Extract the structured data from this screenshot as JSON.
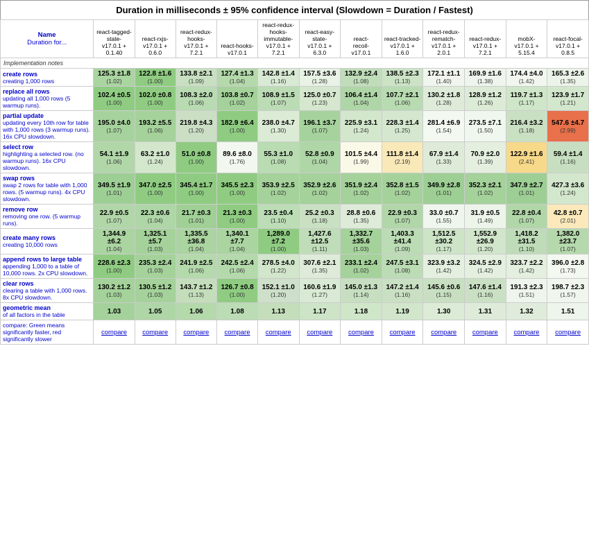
{
  "title": "Duration in milliseconds ± 95% confidence interval (Slowdown = Duration / Fastest)",
  "columns": [
    {
      "id": "name",
      "label": "Name\nDuration for..."
    },
    {
      "id": "c1",
      "label": "react-tagged-state-\nv17.0.1 +\n0.1.40"
    },
    {
      "id": "c2",
      "label": "react-rxjs-\nv17.0.1 +\n0.6.0"
    },
    {
      "id": "c3",
      "label": "react-redux-hooks-\nv17.0.1 +\n7.2.1"
    },
    {
      "id": "c4",
      "label": "react-hooks-\nv17.0.1"
    },
    {
      "id": "c5",
      "label": "react-redux-hooks-immutable-\nv17.0.1 +\n7.2.1"
    },
    {
      "id": "c6",
      "label": "react-easy-state-\nv17.0.1 +\n6.3.0"
    },
    {
      "id": "c7",
      "label": "react-\nrecoil-\nv17.0.1"
    },
    {
      "id": "c8",
      "label": "react-tracked-\nv17.0.1 +\n1.6.0"
    },
    {
      "id": "c9",
      "label": "react-redux-rematch-\nv17.0.1 +\n2.0.1"
    },
    {
      "id": "c10",
      "label": "react-redux-\nv17.0.1 +\n7.2.1"
    },
    {
      "id": "c11",
      "label": "mobX-\nv17.0.1 +\n5.15.4"
    },
    {
      "id": "c12",
      "label": "react-focal-\nv17.0.1 +\n0.8.5"
    }
  ],
  "rows": [
    {
      "id": "impl-notes",
      "label": "Implementation notes",
      "isImplNotes": true,
      "cells": [
        "",
        "",
        "",
        "",
        "",
        "",
        "",
        "",
        "",
        "",
        "",
        ""
      ]
    },
    {
      "id": "create-rows",
      "title": "create rows",
      "desc": "creating 1,000 rows",
      "cells": [
        {
          "v": "125.3",
          "pm": "±1.8",
          "s": "(1.02)",
          "bg": "#aad4a0"
        },
        {
          "v": "122.8",
          "pm": "±1.6",
          "s": "(1.00)",
          "bg": "#8fcc82"
        },
        {
          "v": "133.8",
          "pm": "±2.1",
          "s": "(1.09)",
          "bg": "#c8e0c1"
        },
        {
          "v": "127.4",
          "pm": "±1.3",
          "s": "(1.04)",
          "bg": "#b4d9ab"
        },
        {
          "v": "142.8",
          "pm": "±1.4",
          "s": "(1.16)",
          "bg": "#d9ead4"
        },
        {
          "v": "157.5",
          "pm": "±3.6",
          "s": "(1.28)",
          "bg": "#e8f2e5"
        },
        {
          "v": "132.9",
          "pm": "±2.4",
          "s": "(1.08)",
          "bg": "#c0ddb9"
        },
        {
          "v": "138.5",
          "pm": "±2.3",
          "s": "(1.13)",
          "bg": "#cce3c6"
        },
        {
          "v": "172.1",
          "pm": "±1.1",
          "s": "(1.40)",
          "bg": "#f0f6ee"
        },
        {
          "v": "169.9",
          "pm": "±1.6",
          "s": "(1.38)",
          "bg": "#eef5ec"
        },
        {
          "v": "174.4",
          "pm": "±4.0",
          "s": "(1.42)",
          "bg": "#f1f7ef"
        },
        {
          "v": "165.3",
          "pm": "±2.6",
          "s": "(1.35)",
          "bg": "#ecf4e9"
        }
      ]
    },
    {
      "id": "replace-all",
      "title": "replace all rows",
      "desc": "updating all 1,000 rows (5 warmup runs).",
      "cells": [
        {
          "v": "102.4",
          "pm": "±0.5",
          "s": "(1.00)",
          "bg": "#8fcc82"
        },
        {
          "v": "102.0",
          "pm": "±0.8",
          "s": "(1.00)",
          "bg": "#8fcc82"
        },
        {
          "v": "108.3",
          "pm": "±2.0",
          "s": "(1.06)",
          "bg": "#b8dbb1"
        },
        {
          "v": "103.8",
          "pm": "±0.7",
          "s": "(1.02)",
          "bg": "#a4d29a"
        },
        {
          "v": "108.9",
          "pm": "±1.5",
          "s": "(1.07)",
          "bg": "#bbdcb4"
        },
        {
          "v": "125.0",
          "pm": "±0.7",
          "s": "(1.23)",
          "bg": "#d5e8cf"
        },
        {
          "v": "106.4",
          "pm": "±1.4",
          "s": "(1.04)",
          "bg": "#afd6a7"
        },
        {
          "v": "107.7",
          "pm": "±2.1",
          "s": "(1.06)",
          "bg": "#b8dbb1"
        },
        {
          "v": "130.2",
          "pm": "±1.8",
          "s": "(1.28)",
          "bg": "#deebd9"
        },
        {
          "v": "128.9",
          "pm": "±1.2",
          "s": "(1.26)",
          "bg": "#dcebd6"
        },
        {
          "v": "119.7",
          "pm": "±1.3",
          "s": "(1.17)",
          "bg": "#cfe6c9"
        },
        {
          "v": "123.9",
          "pm": "±1.7",
          "s": "(1.21)",
          "bg": "#d3e7cd"
        }
      ]
    },
    {
      "id": "partial-update",
      "title": "partial update",
      "desc": "updating every 10th row for table with 1,000 rows (3 warmup runs). 16x CPU slowdown.",
      "cells": [
        {
          "v": "195.0",
          "pm": "±4.0",
          "s": "(1.07)",
          "bg": "#a6d39d"
        },
        {
          "v": "193.2",
          "pm": "±5.5",
          "s": "(1.06)",
          "bg": "#a4d29a"
        },
        {
          "v": "219.8",
          "pm": "±4.3",
          "s": "(1.20)",
          "bg": "#cbdfc5"
        },
        {
          "v": "182.9",
          "pm": "±6.4",
          "s": "(1.00)",
          "bg": "#8fcc82"
        },
        {
          "v": "238.0",
          "pm": "±4.7",
          "s": "(1.30)",
          "bg": "#dbebd5"
        },
        {
          "v": "196.1",
          "pm": "±3.7",
          "s": "(1.07)",
          "bg": "#a6d39d"
        },
        {
          "v": "225.9",
          "pm": "±3.1",
          "s": "(1.24)",
          "bg": "#d3e7cd"
        },
        {
          "v": "228.3",
          "pm": "±1.4",
          "s": "(1.25)",
          "bg": "#d5e8cf"
        },
        {
          "v": "281.4",
          "pm": "±6.9",
          "s": "(1.54)",
          "bg": "#f3f8f1"
        },
        {
          "v": "273.5",
          "pm": "±7.1",
          "s": "(1.50)",
          "bg": "#f0f7ee"
        },
        {
          "v": "216.4",
          "pm": "±3.2",
          "s": "(1.18)",
          "bg": "#cae0c3"
        },
        {
          "v": "547.6",
          "pm": "±4.7",
          "s": "(2.99)",
          "bg": "#e8704a"
        }
      ]
    },
    {
      "id": "select-row",
      "title": "select row",
      "desc": "highlighting a selected row. (no warmup runs). 16x CPU slowdown.",
      "cells": [
        {
          "v": "54.1",
          "pm": "±1.9",
          "s": "(1.06)",
          "bg": "#b1d7a9"
        },
        {
          "v": "63.2",
          "pm": "±1.0",
          "s": "(1.24)",
          "bg": "#d3e7cd"
        },
        {
          "v": "51.0",
          "pm": "±0.8",
          "s": "(1.00)",
          "bg": "#8fcc82"
        },
        {
          "v": "89.6",
          "pm": "±8.0",
          "s": "(1.76)",
          "bg": "#f2f7f0"
        },
        {
          "v": "55.3",
          "pm": "±1.0",
          "s": "(1.08)",
          "bg": "#b9dcb2"
        },
        {
          "v": "52.8",
          "pm": "±0.9",
          "s": "(1.04)",
          "bg": "#aed6a6"
        },
        {
          "v": "101.5",
          "pm": "±4.4",
          "s": "(1.99)",
          "bg": "#faf8e7"
        },
        {
          "v": "111.8",
          "pm": "±1.4",
          "s": "(2.19)",
          "bg": "#f9e8b8"
        },
        {
          "v": "67.9",
          "pm": "±1.4",
          "s": "(1.33)",
          "bg": "#deebd9"
        },
        {
          "v": "70.9",
          "pm": "±2.0",
          "s": "(1.39)",
          "bg": "#e4efdf"
        },
        {
          "v": "122.9",
          "pm": "±1.6",
          "s": "(2.41)",
          "bg": "#f7d98a"
        },
        {
          "v": "59.4",
          "pm": "±1.4",
          "s": "(1.16)",
          "bg": "#c7dfc0"
        }
      ]
    },
    {
      "id": "swap-rows",
      "title": "swap rows",
      "desc": "swap 2 rows for table with 1,000 rows. (5 warmup runs). 4x CPU slowdown.",
      "cells": [
        {
          "v": "349.5",
          "pm": "±1.9",
          "s": "(1.01)",
          "bg": "#9dcf94"
        },
        {
          "v": "347.0",
          "pm": "±2.5",
          "s": "(1.00)",
          "bg": "#8fcc82"
        },
        {
          "v": "345.4",
          "pm": "±1.7",
          "s": "(1.00)",
          "bg": "#8fcc82"
        },
        {
          "v": "345.5",
          "pm": "±2.3",
          "s": "(1.00)",
          "bg": "#8fcc82"
        },
        {
          "v": "353.9",
          "pm": "±2.5",
          "s": "(1.02)",
          "bg": "#a4d29a"
        },
        {
          "v": "352.9",
          "pm": "±2.6",
          "s": "(1.02)",
          "bg": "#a4d29a"
        },
        {
          "v": "351.9",
          "pm": "±2.4",
          "s": "(1.02)",
          "bg": "#a4d29a"
        },
        {
          "v": "352.8",
          "pm": "±1.5",
          "s": "(1.02)",
          "bg": "#a4d29a"
        },
        {
          "v": "349.9",
          "pm": "±2.8",
          "s": "(1.01)",
          "bg": "#9dcf94"
        },
        {
          "v": "352.3",
          "pm": "±2.1",
          "s": "(1.02)",
          "bg": "#a4d29a"
        },
        {
          "v": "347.9",
          "pm": "±2.7",
          "s": "(1.01)",
          "bg": "#9dcf94"
        },
        {
          "v": "427.3",
          "pm": "±3.6",
          "s": "(1.24)",
          "bg": "#d3e7cd"
        }
      ]
    },
    {
      "id": "remove-row",
      "title": "remove row",
      "desc": "removing one row. (5 warmup runs).",
      "cells": [
        {
          "v": "22.9",
          "pm": "±0.5",
          "s": "(1.07)",
          "bg": "#b1d7a9"
        },
        {
          "v": "22.3",
          "pm": "±0.6",
          "s": "(1.04)",
          "bg": "#aed6a6"
        },
        {
          "v": "21.7",
          "pm": "±0.3",
          "s": "(1.01)",
          "bg": "#a0d096"
        },
        {
          "v": "21.3",
          "pm": "±0.3",
          "s": "(1.00)",
          "bg": "#8fcc82"
        },
        {
          "v": "23.5",
          "pm": "±0.4",
          "s": "(1.10)",
          "bg": "#bcddb5"
        },
        {
          "v": "25.2",
          "pm": "±0.3",
          "s": "(1.18)",
          "bg": "#cae0c3"
        },
        {
          "v": "28.8",
          "pm": "±0.6",
          "s": "(1.35)",
          "bg": "#deebd9"
        },
        {
          "v": "22.9",
          "pm": "±0.3",
          "s": "(1.07)",
          "bg": "#b1d7a9"
        },
        {
          "v": "33.0",
          "pm": "±0.7",
          "s": "(1.55)",
          "bg": "#eff6ed"
        },
        {
          "v": "31.9",
          "pm": "±0.5",
          "s": "(1.49)",
          "bg": "#edf5ea"
        },
        {
          "v": "22.8",
          "pm": "±0.4",
          "s": "(1.07)",
          "bg": "#b1d7a9"
        },
        {
          "v": "42.8",
          "pm": "±0.7",
          "s": "(2.01)",
          "bg": "#fbe9bb"
        }
      ]
    },
    {
      "id": "create-many",
      "title": "create many rows",
      "desc": "creating 10,000 rows",
      "cells": [
        {
          "v": "1,344.9",
          "pm": "±6.2",
          "s": "(1.04)",
          "bg": "#aad4a0"
        },
        {
          "v": "1,325.1",
          "pm": "±5.7",
          "s": "(1.03)",
          "bg": "#a4d29a"
        },
        {
          "v": "1,335.5",
          "pm": "±36.8",
          "s": "(1.04)",
          "bg": "#aad4a0"
        },
        {
          "v": "1,340.1",
          "pm": "±7.7",
          "s": "(1.04)",
          "bg": "#aad4a0"
        },
        {
          "v": "1,289.0",
          "pm": "±7.2",
          "s": "(1.00)",
          "bg": "#8fcc82"
        },
        {
          "v": "1,427.6",
          "pm": "±12.5",
          "s": "(1.11)",
          "bg": "#c0ddb9"
        },
        {
          "v": "1,332.7",
          "pm": "±35.6",
          "s": "(1.03)",
          "bg": "#a4d29a"
        },
        {
          "v": "1,403.3",
          "pm": "±41.4",
          "s": "(1.09)",
          "bg": "#bbdcb4"
        },
        {
          "v": "1,512.5",
          "pm": "±30.2",
          "s": "(1.17)",
          "bg": "#cde4c7"
        },
        {
          "v": "1,552.9",
          "pm": "±26.9",
          "s": "(1.20)",
          "bg": "#d1e6cb"
        },
        {
          "v": "1,418.2",
          "pm": "±31.5",
          "s": "(1.10)",
          "bg": "#bfdcb8"
        },
        {
          "v": "1,382.0",
          "pm": "±23.7",
          "s": "(1.07)",
          "bg": "#b5d9ac"
        }
      ]
    },
    {
      "id": "append-rows",
      "title": "append rows to large table",
      "desc": "appending 1,000 to a table of 10,000 rows. 2x CPU slowdown.",
      "cells": [
        {
          "v": "228.6",
          "pm": "±2.3",
          "s": "(1.00)",
          "bg": "#8fcc82"
        },
        {
          "v": "235.3",
          "pm": "±2.4",
          "s": "(1.03)",
          "bg": "#a4d29a"
        },
        {
          "v": "241.9",
          "pm": "±2.5",
          "s": "(1.06)",
          "bg": "#b4d9ab"
        },
        {
          "v": "242.5",
          "pm": "±2.4",
          "s": "(1.06)",
          "bg": "#b4d9ab"
        },
        {
          "v": "278.5",
          "pm": "±4.0",
          "s": "(1.22)",
          "bg": "#d1e6cb"
        },
        {
          "v": "307.6",
          "pm": "±2.1",
          "s": "(1.35)",
          "bg": "#deebd9"
        },
        {
          "v": "233.1",
          "pm": "±2.4",
          "s": "(1.02)",
          "bg": "#a4d29a"
        },
        {
          "v": "247.5",
          "pm": "±3.1",
          "s": "(1.08)",
          "bg": "#bbdcb4"
        },
        {
          "v": "323.9",
          "pm": "±3.2",
          "s": "(1.42)",
          "bg": "#e4efdf"
        },
        {
          "v": "324.5",
          "pm": "±2.9",
          "s": "(1.42)",
          "bg": "#e4efdf"
        },
        {
          "v": "323.7",
          "pm": "±2.2",
          "s": "(1.42)",
          "bg": "#e4efdf"
        },
        {
          "v": "396.0",
          "pm": "±2.8",
          "s": "(1.73)",
          "bg": "#f3f8f1"
        }
      ]
    },
    {
      "id": "clear-rows",
      "title": "clear rows",
      "desc": "clearing a table with 1,000 rows. 8x CPU slowdown.",
      "cells": [
        {
          "v": "130.2",
          "pm": "±1.2",
          "s": "(1.03)",
          "bg": "#a4d29a"
        },
        {
          "v": "130.5",
          "pm": "±1.2",
          "s": "(1.03)",
          "bg": "#a4d29a"
        },
        {
          "v": "143.7",
          "pm": "±1.2",
          "s": "(1.13)",
          "bg": "#c4debb"
        },
        {
          "v": "126.7",
          "pm": "±0.8",
          "s": "(1.00)",
          "bg": "#8fcc82"
        },
        {
          "v": "152.1",
          "pm": "±1.0",
          "s": "(1.20)",
          "bg": "#cedfca"
        },
        {
          "v": "160.6",
          "pm": "±1.9",
          "s": "(1.27)",
          "bg": "#d9ead4"
        },
        {
          "v": "145.0",
          "pm": "±1.3",
          "s": "(1.14)",
          "bg": "#c7dfc0"
        },
        {
          "v": "147.2",
          "pm": "±1.4",
          "s": "(1.16)",
          "bg": "#cae0c3"
        },
        {
          "v": "145.6",
          "pm": "±0.6",
          "s": "(1.15)",
          "bg": "#c8e0c1"
        },
        {
          "v": "147.6",
          "pm": "±1.4",
          "s": "(1.16)",
          "bg": "#cae0c3"
        },
        {
          "v": "191.3",
          "pm": "±2.3",
          "s": "(1.51)",
          "bg": "#eef5ec"
        },
        {
          "v": "198.7",
          "pm": "±2.3",
          "s": "(1.57)",
          "bg": "#f0f6ee"
        }
      ]
    },
    {
      "id": "geo-mean",
      "title": "geometric mean",
      "desc": "of all factors in the table",
      "cells": [
        {
          "v": "1.03",
          "pm": "",
          "s": "",
          "bg": "#a4d29a"
        },
        {
          "v": "1.05",
          "pm": "",
          "s": "",
          "bg": "#aed6a6"
        },
        {
          "v": "1.06",
          "pm": "",
          "s": "",
          "bg": "#b4d9ab"
        },
        {
          "v": "1.08",
          "pm": "",
          "s": "",
          "bg": "#bbdcb4"
        },
        {
          "v": "1.13",
          "pm": "",
          "s": "",
          "bg": "#c4debb"
        },
        {
          "v": "1.17",
          "pm": "",
          "s": "",
          "bg": "#cde4c7"
        },
        {
          "v": "1.18",
          "pm": "",
          "s": "",
          "bg": "#cfe6c9"
        },
        {
          "v": "1.19",
          "pm": "",
          "s": "",
          "bg": "#d1e6cb"
        },
        {
          "v": "1.30",
          "pm": "",
          "s": "",
          "bg": "#dcebd6"
        },
        {
          "v": "1.31",
          "pm": "",
          "s": "",
          "bg": "#deebd9"
        },
        {
          "v": "1.32",
          "pm": "",
          "s": "",
          "bg": "#e0ecdb"
        },
        {
          "v": "1.51",
          "pm": "",
          "s": "",
          "bg": "#eef5ec"
        }
      ]
    },
    {
      "id": "compare",
      "isCompare": true,
      "desc": "compare: Green means significantly faster, red significantly slower",
      "cells": [
        "compare",
        "compare",
        "compare",
        "compare",
        "compare",
        "compare",
        "compare",
        "compare",
        "compare",
        "compare",
        "compare",
        "compare"
      ]
    }
  ]
}
